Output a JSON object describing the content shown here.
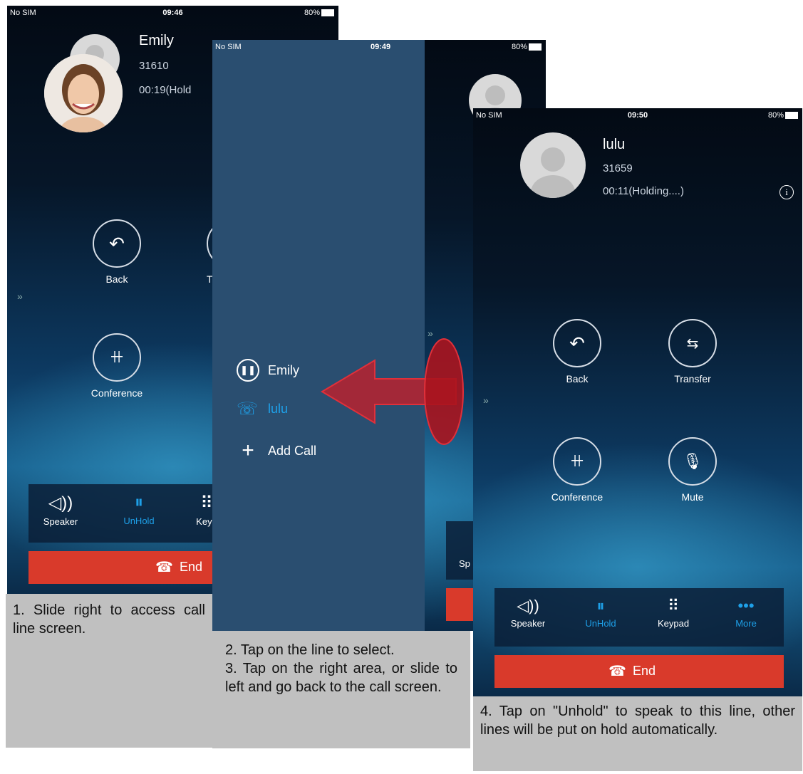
{
  "screen1": {
    "status": {
      "carrier": "No SIM",
      "time": "09:46",
      "battery": "80%"
    },
    "contact": {
      "name": "Emily",
      "number": "31610",
      "duration": "00:19(Hold"
    },
    "controls": {
      "back": "Back",
      "transfer_partial": "T",
      "conference": "Conference"
    },
    "toolbar": {
      "speaker": "Speaker",
      "unhold": "UnHold",
      "keypad_partial": "Keyp"
    },
    "end_label": "End",
    "caption": "1. Slide right to access call line screen."
  },
  "screen2": {
    "status": {
      "carrier": "No SIM",
      "time": "09:49",
      "battery": "80%"
    },
    "lines": [
      {
        "label": "Emily",
        "icon": "pause-circle-icon"
      },
      {
        "label": "lulu",
        "icon": "phone-transfer-icon"
      },
      {
        "label": "Add Call",
        "icon": "plus-icon"
      }
    ],
    "toolbar_partial": "Sp",
    "caption_lines": [
      "2. Tap on the line to select.",
      "3. Tap on the right area, or slide to left and go back to the call screen."
    ]
  },
  "screen3": {
    "status": {
      "carrier": "No SIM",
      "time": "09:50",
      "battery": "80%"
    },
    "contact": {
      "name": "lulu",
      "number": "31659",
      "duration": "00:11(Holding....)"
    },
    "controls": {
      "back": "Back",
      "transfer": "Transfer",
      "conference": "Conference",
      "mute": "Mute"
    },
    "toolbar": {
      "speaker": "Speaker",
      "unhold": "UnHold",
      "keypad": "Keypad",
      "more": "More"
    },
    "end_label": "End",
    "caption": "4. Tap on \"Unhold\" to speak to this line, other lines will be put on hold automatically."
  },
  "colors": {
    "accent": "#1ea0e8",
    "end": "#d93a2b",
    "arrow": "#b8222e",
    "panel": "#2a4e70",
    "caption": "#c0c0c0"
  }
}
